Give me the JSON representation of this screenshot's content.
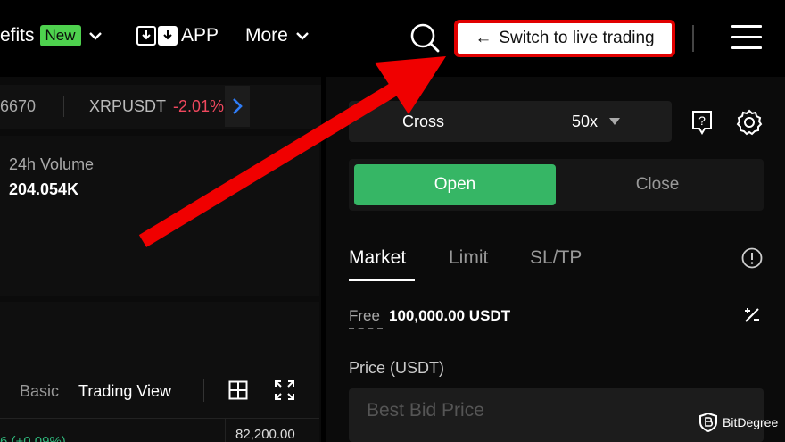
{
  "nav": {
    "benefits_label": "efits",
    "new_badge": "New",
    "app_label": "APP",
    "more_label": "More",
    "switch_label": "Switch to live trading",
    "switch_arrow": "←",
    "chevron": "∨"
  },
  "ticker": {
    "prev_value": "6670",
    "symbol": "XRPUSDT",
    "change": "-2.01%",
    "next_glyph": "❯"
  },
  "stats": {
    "volume_label": "24h Volume",
    "volume_value": "204.054K"
  },
  "chart": {
    "view_basic": "Basic",
    "view_trading": "Trading View",
    "price_tick": "82,200.00",
    "change_text": "6 (+0.09%)"
  },
  "order": {
    "margin_mode": "Cross",
    "leverage": "50x",
    "open_label": "Open",
    "close_label": "Close",
    "tabs": [
      "Market",
      "Limit",
      "SL/TP"
    ],
    "free_label": "Free",
    "free_value": "100,000.00 USDT",
    "price_label": "Price (USDT)",
    "price_placeholder": "Best Bid Price"
  },
  "watermark": {
    "text": "BitDegree"
  },
  "colors": {
    "accent_green": "#36b665",
    "badge_green": "#4ed14e",
    "negative_red": "#f0485e",
    "annotation_red": "#e10000"
  }
}
